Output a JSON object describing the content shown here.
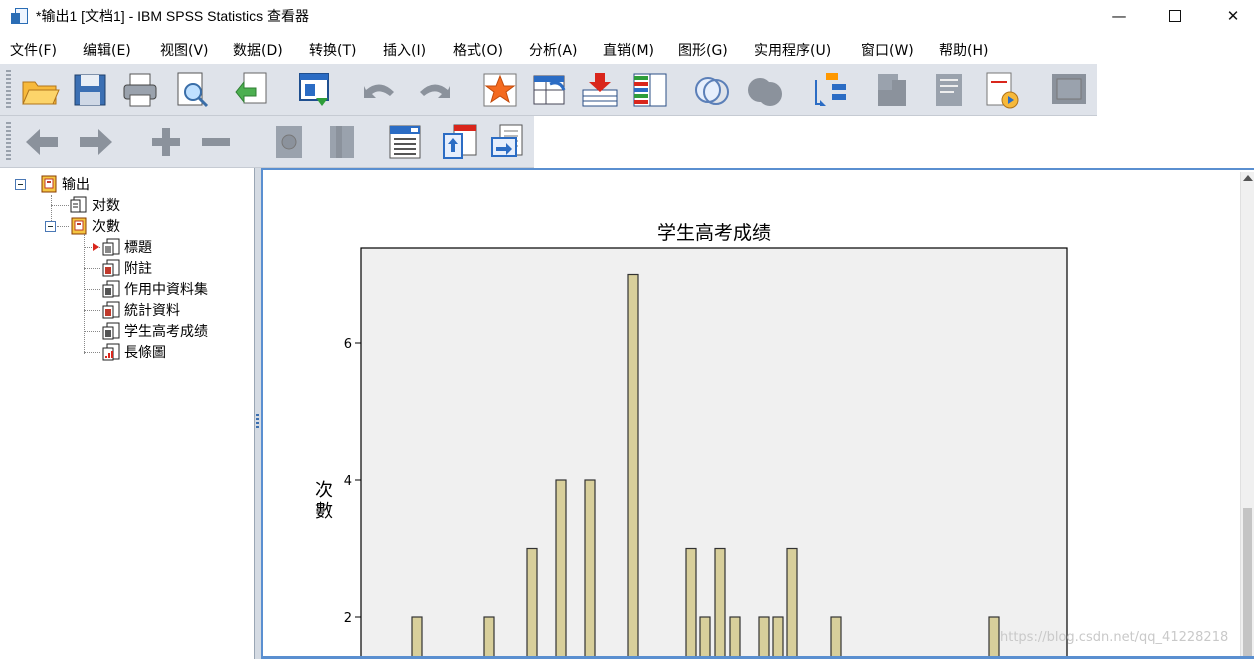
{
  "window": {
    "title": "*输出1 [文档1] - IBM SPSS Statistics 查看器",
    "min_glyph": "—",
    "close_glyph": "✕"
  },
  "menu": [
    {
      "label": "文件(F)",
      "name": "menu-file"
    },
    {
      "label": "编辑(E)",
      "name": "menu-edit"
    },
    {
      "label": "视图(V)",
      "name": "menu-view"
    },
    {
      "label": "数据(D)",
      "name": "menu-data"
    },
    {
      "label": "转换(T)",
      "name": "menu-transform"
    },
    {
      "label": "插入(I)",
      "name": "menu-insert"
    },
    {
      "label": "格式(O)",
      "name": "menu-format"
    },
    {
      "label": "分析(A)",
      "name": "menu-analyze"
    },
    {
      "label": "直销(M)",
      "name": "menu-direct-marketing"
    },
    {
      "label": "图形(G)",
      "name": "menu-graphs"
    },
    {
      "label": "实用程序(U)",
      "name": "menu-utilities"
    },
    {
      "label": "窗口(W)",
      "name": "menu-window"
    },
    {
      "label": "帮助(H)",
      "name": "menu-help"
    }
  ],
  "toolbar1": [
    "open-folder-icon",
    "save-icon",
    "print-icon",
    "print-preview-icon",
    "export-icon",
    "recall-dialog-icon",
    "undo-icon",
    "redo-icon",
    "goto-case-icon",
    "goto-variable-icon",
    "insert-cases-icon",
    "variables-icon",
    "select-cases-icon",
    "weight-cases-icon",
    "split-file-icon",
    "value-labels-icon",
    "use-sets-icon",
    "show-all-icon",
    "run-script-icon",
    "designate-window-icon"
  ],
  "toolbar2": [
    "promote-icon",
    "demote-icon",
    "expand-icon",
    "collapse-icon",
    "show-icon",
    "hide-icon",
    "insert-heading-icon",
    "insert-title-icon",
    "insert-text-icon"
  ],
  "tree": {
    "root": "输出",
    "log": "对数",
    "freq": "次數",
    "items": [
      "標題",
      "附註",
      "作用中資料集",
      "統計資料",
      "学生高考成绩",
      "長條圖"
    ]
  },
  "watermark": "https://blog.csdn.net/qq_41228218",
  "colors": {
    "bar_fill": "#d8cf9b",
    "bar_stroke": "#333333",
    "plot_bg": "#f0f0f0",
    "accent": "#5a8fd0"
  },
  "chart_data": {
    "type": "bar",
    "title": "学生高考成绩",
    "ylabel": "次數",
    "yticks": [
      2,
      4,
      6
    ],
    "ylim": [
      0,
      7.5
    ],
    "values": [
      2,
      2,
      3,
      4,
      4,
      7,
      3,
      2,
      3,
      2,
      2,
      2,
      3,
      2,
      2
    ]
  }
}
